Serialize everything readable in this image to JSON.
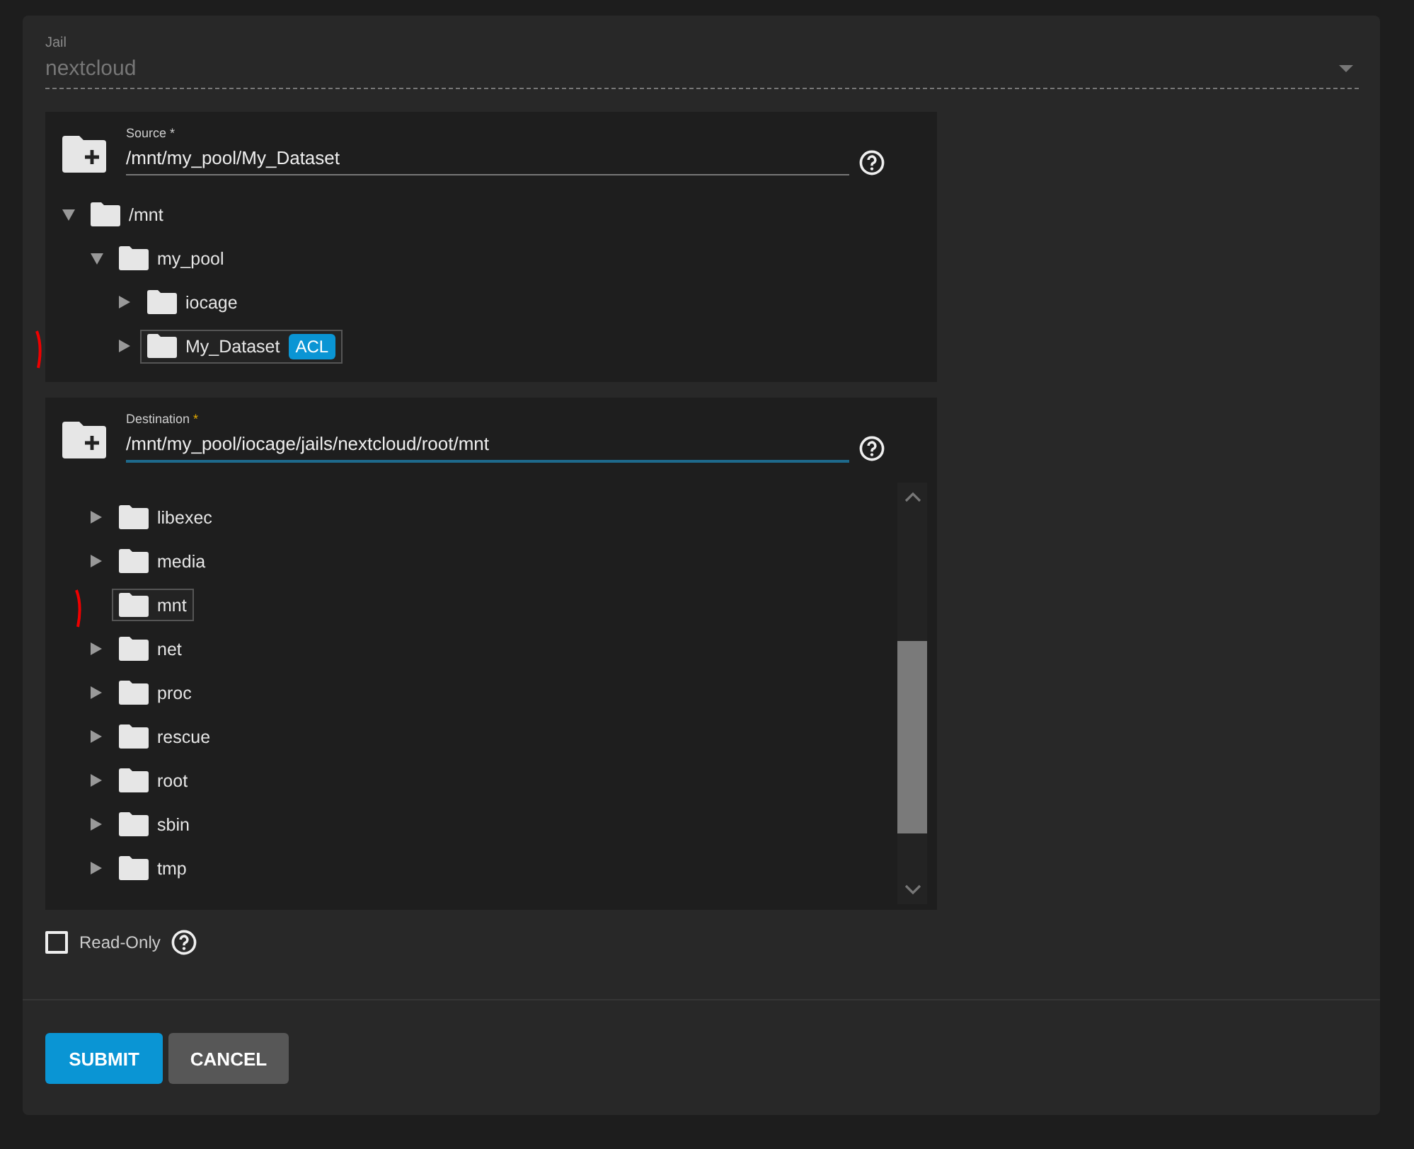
{
  "jail": {
    "label": "Jail",
    "value": "nextcloud",
    "disabled": true
  },
  "source": {
    "label": "Source",
    "required": "*",
    "value": "/mnt/my_pool/My_Dataset",
    "focused": false,
    "tree": [
      {
        "name": "/mnt",
        "kind": "branch",
        "expanded": true,
        "selected": false,
        "children": [
          {
            "name": "my_pool",
            "kind": "branch",
            "expanded": true,
            "selected": false,
            "children": [
              {
                "name": "iocage",
                "kind": "branch",
                "expanded": false,
                "selected": false
              },
              {
                "name": "My_Dataset",
                "kind": "branch",
                "expanded": false,
                "selected": true,
                "badge": "ACL"
              }
            ]
          }
        ]
      }
    ]
  },
  "destination": {
    "label": "Destination",
    "required": "*",
    "value": "/mnt/my_pool/iocage/jails/nextcloud/root/mnt",
    "focused": true,
    "tree": [
      {
        "name": "libexec",
        "kind": "branch",
        "expanded": false,
        "selected": false
      },
      {
        "name": "media",
        "kind": "branch",
        "expanded": false,
        "selected": false
      },
      {
        "name": "mnt",
        "kind": "leaf",
        "selected": true
      },
      {
        "name": "net",
        "kind": "branch",
        "expanded": false,
        "selected": false
      },
      {
        "name": "proc",
        "kind": "branch",
        "expanded": false,
        "selected": false
      },
      {
        "name": "rescue",
        "kind": "branch",
        "expanded": false,
        "selected": false
      },
      {
        "name": "root",
        "kind": "branch",
        "expanded": false,
        "selected": false
      },
      {
        "name": "sbin",
        "kind": "branch",
        "expanded": false,
        "selected": false
      },
      {
        "name": "tmp",
        "kind": "branch",
        "expanded": false,
        "selected": false
      }
    ]
  },
  "read_only": {
    "label": "Read-Only",
    "checked": false
  },
  "buttons": [
    {
      "label": "SUBMIT",
      "kind": "primary"
    },
    {
      "label": "CANCEL",
      "kind": "secondary"
    }
  ]
}
